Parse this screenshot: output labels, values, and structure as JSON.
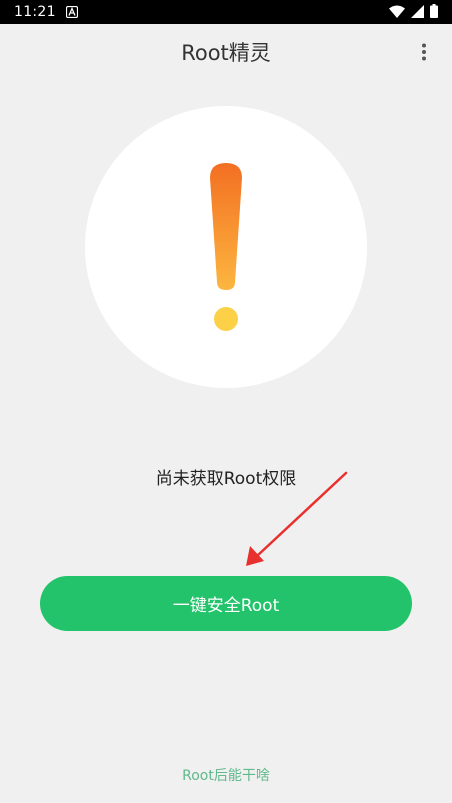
{
  "status_bar": {
    "time": "11:21",
    "notification_icon": "a-letter-icon",
    "wifi_icon": "wifi-icon",
    "cell_icon": "cell-signal-icon",
    "battery_icon": "battery-icon"
  },
  "app_bar": {
    "title": "Root精灵",
    "menu_icon": "more-vert-icon"
  },
  "main": {
    "status_icon": "exclamation-icon",
    "status_text": "尚未获取Root权限",
    "root_button_label": "一键安全Root",
    "help_link": "Root后能干啥"
  },
  "colors": {
    "background": "#f0f0f0",
    "circle": "#ffffff",
    "button": "#22c36a",
    "exclamation_top": "#f36f22",
    "exclamation_bottom": "#fcd148",
    "arrow": "#e8312f",
    "help_link": "#5fb98c"
  }
}
